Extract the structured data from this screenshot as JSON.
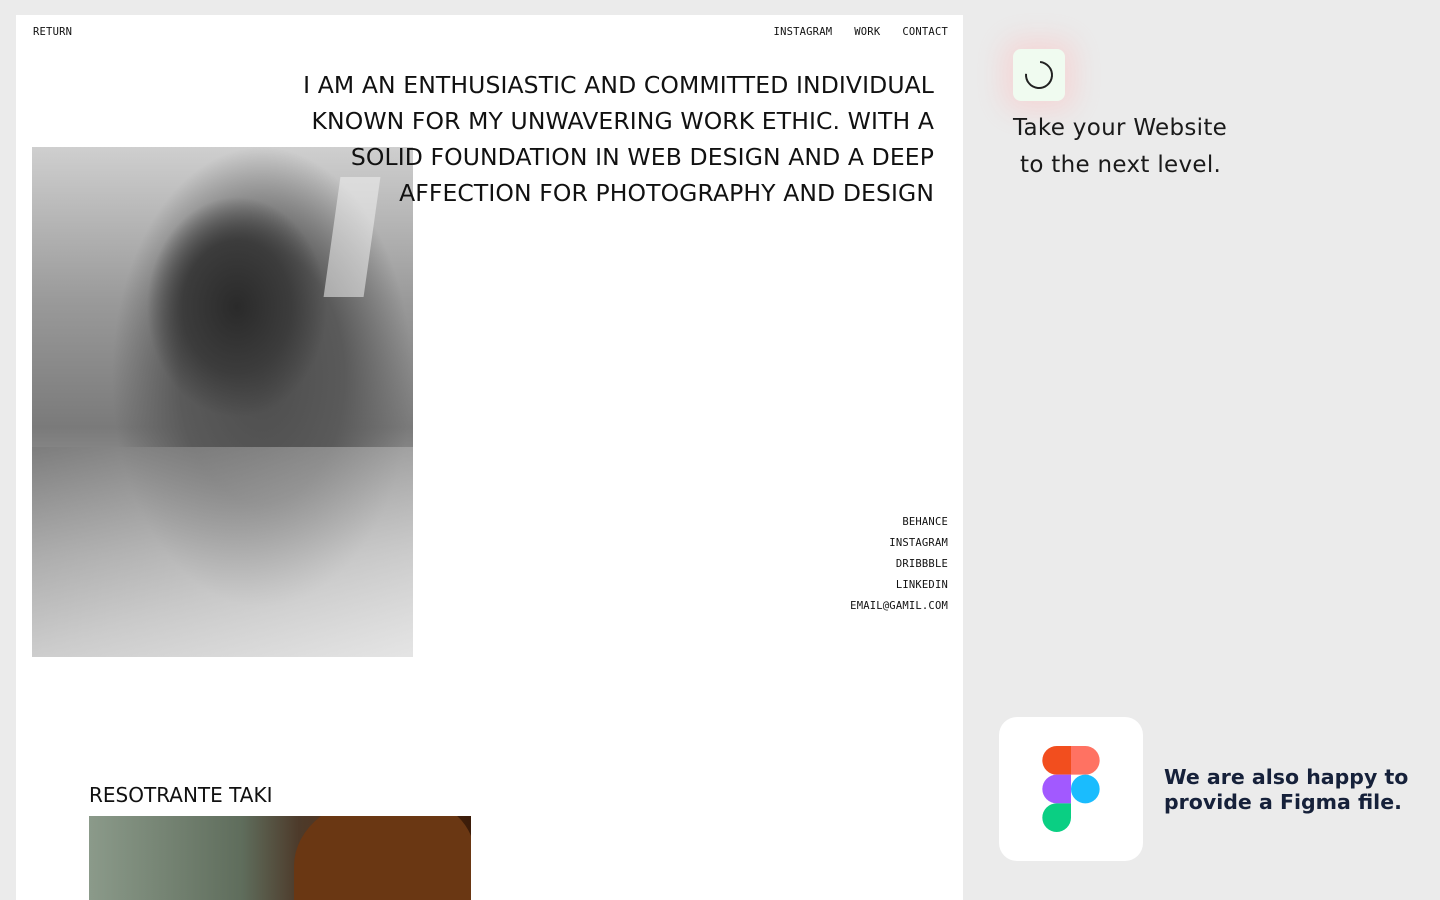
{
  "nav": {
    "return_label": "RETURN",
    "links": [
      "INSTAGRAM",
      "WORK",
      "CONTACT"
    ]
  },
  "hero": {
    "headline": "I AM AN ENTHUSIASTIC AND COMMITTED INDIVIDUAL KNOWN FOR MY UNWAVERING WORK ETHIC. WITH A SOLID FOUNDATION IN WEB DESIGN AND A DEEP AFFECTION FOR PHOTOGRAPHY AND DESIGN"
  },
  "social_links": [
    "BEHANCE",
    "INSTAGRAM",
    "DRIBBBLE",
    "LINKEDIN",
    "EMAIL@GAMIL.COM"
  ],
  "project": {
    "title": "RESOTRANTE TAKI"
  },
  "promo": {
    "icon": "loading-spinner-icon",
    "line1": "Take your Website",
    "line2": "to the next level."
  },
  "figma": {
    "icon": "figma-logo-icon",
    "text": "We are also happy to provide a Figma file.",
    "colors": [
      "#f24e1e",
      "#ff7262",
      "#a259ff",
      "#1abcfe",
      "#0acf83"
    ]
  }
}
